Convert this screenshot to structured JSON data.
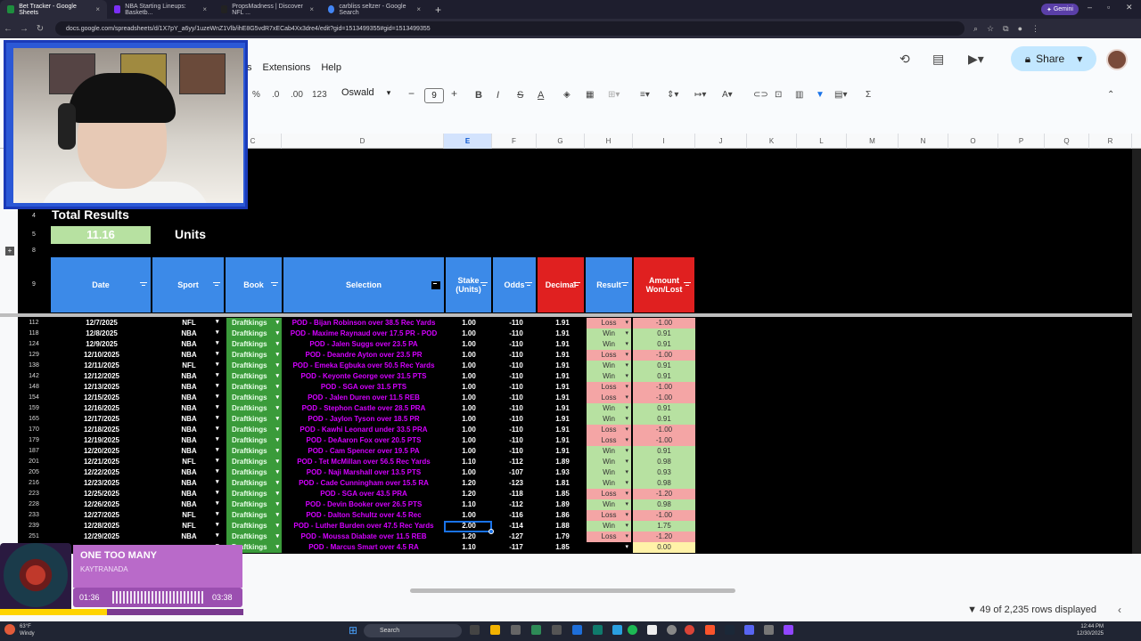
{
  "browser": {
    "tabs": [
      {
        "label": "Bet Tracker - Google Sheets",
        "color": "#1e8e3e",
        "active": true
      },
      {
        "label": "NBA Starting Lineups: Basketb...",
        "color": "#7b2ff7",
        "active": false
      },
      {
        "label": "PropsMadness | Discover NFL ...",
        "color": "#222222",
        "active": false
      },
      {
        "label": "carbliss seltzer - Google Search",
        "color": "#4285f4",
        "active": false
      }
    ],
    "new_tab": "+",
    "gemini_label": "Gemini",
    "url": "docs.google.com/spreadsheets/d/1X7pY_a6yy/1uzeWnZ1Vlb/ihE8G5vdR7xECab4Xx3dre4/edit?gid=1513499355#gid=1513499355"
  },
  "sheets": {
    "menu": [
      "s",
      "Extensions",
      "Help"
    ],
    "share_label": "Share",
    "toolbar": {
      "percent": "%",
      "dec_less": ".0",
      "dec_more": ".00",
      "numformat": "123",
      "font": "Oswald",
      "font_size": "9",
      "minus": "−",
      "plus": "+",
      "bold": "B",
      "italic": "I",
      "strike": "S",
      "text_color": "A",
      "sigma": "Σ"
    },
    "columns": [
      "C",
      "D",
      "E",
      "F",
      "G",
      "H",
      "I",
      "J",
      "K",
      "L",
      "M",
      "N",
      "O",
      "P",
      "Q",
      "R"
    ],
    "selected_column": "E",
    "row_numbers": {
      "r4": "4",
      "r5": "5",
      "r8": "8",
      "r9": "9"
    },
    "totals_label": "Total Results",
    "units_value": "11.16",
    "units_label": "Units",
    "headers": {
      "date": "Date",
      "sport": "Sport",
      "book": "Book",
      "selection": "Selection",
      "stake": "Stake (Units)",
      "odds": "Odds",
      "decimal": "Decimal",
      "result": "Result",
      "amount": "Amount Won/Lost"
    },
    "rows": [
      {
        "row": "112",
        "date": "12/7/2025",
        "sport": "NFL",
        "book": "Draftkings",
        "selection": "POD - Bijan Robinson over 38.5 Rec Yards",
        "stake": "1.00",
        "odds": "-110",
        "decimal": "1.91",
        "result": "Loss",
        "amount": "-1.00"
      },
      {
        "row": "118",
        "date": "12/8/2025",
        "sport": "NBA",
        "book": "Draftkings",
        "selection": "POD - Maxime Raynaud over 17.5 PR - POD",
        "stake": "1.00",
        "odds": "-110",
        "decimal": "1.91",
        "result": "Win",
        "amount": "0.91"
      },
      {
        "row": "124",
        "date": "12/9/2025",
        "sport": "NBA",
        "book": "Draftkings",
        "selection": "POD - Jalen Suggs over 23.5 PA",
        "stake": "1.00",
        "odds": "-110",
        "decimal": "1.91",
        "result": "Win",
        "amount": "0.91"
      },
      {
        "row": "129",
        "date": "12/10/2025",
        "sport": "NBA",
        "book": "Draftkings",
        "selection": "POD - Deandre Ayton over 23.5 PR",
        "stake": "1.00",
        "odds": "-110",
        "decimal": "1.91",
        "result": "Loss",
        "amount": "-1.00"
      },
      {
        "row": "138",
        "date": "12/11/2025",
        "sport": "NFL",
        "book": "Draftkings",
        "selection": "POD - Emeka Egbuka over 50.5 Rec Yards",
        "stake": "1.00",
        "odds": "-110",
        "decimal": "1.91",
        "result": "Win",
        "amount": "0.91"
      },
      {
        "row": "142",
        "date": "12/12/2025",
        "sport": "NBA",
        "book": "Draftkings",
        "selection": "POD - Keyonte George over 31.5 PTS",
        "stake": "1.00",
        "odds": "-110",
        "decimal": "1.91",
        "result": "Win",
        "amount": "0.91"
      },
      {
        "row": "148",
        "date": "12/13/2025",
        "sport": "NBA",
        "book": "Draftkings",
        "selection": "POD - SGA over 31.5 PTS",
        "stake": "1.00",
        "odds": "-110",
        "decimal": "1.91",
        "result": "Loss",
        "amount": "-1.00"
      },
      {
        "row": "154",
        "date": "12/15/2025",
        "sport": "NBA",
        "book": "Draftkings",
        "selection": "POD - Jalen Duren over 11.5 REB",
        "stake": "1.00",
        "odds": "-110",
        "decimal": "1.91",
        "result": "Loss",
        "amount": "-1.00"
      },
      {
        "row": "159",
        "date": "12/16/2025",
        "sport": "NBA",
        "book": "Draftkings",
        "selection": "POD - Stephon Castle over 28.5 PRA",
        "stake": "1.00",
        "odds": "-110",
        "decimal": "1.91",
        "result": "Win",
        "amount": "0.91"
      },
      {
        "row": "165",
        "date": "12/17/2025",
        "sport": "NBA",
        "book": "Draftkings",
        "selection": "POD - Jaylon Tyson over 18.5 PR",
        "stake": "1.00",
        "odds": "-110",
        "decimal": "1.91",
        "result": "Win",
        "amount": "0.91"
      },
      {
        "row": "170",
        "date": "12/18/2025",
        "sport": "NBA",
        "book": "Draftkings",
        "selection": "POD - Kawhi Leonard under 33.5 PRA",
        "stake": "1.00",
        "odds": "-110",
        "decimal": "1.91",
        "result": "Loss",
        "amount": "-1.00"
      },
      {
        "row": "179",
        "date": "12/19/2025",
        "sport": "NBA",
        "book": "Draftkings",
        "selection": "POD - DeAaron Fox over 20.5 PTS",
        "stake": "1.00",
        "odds": "-110",
        "decimal": "1.91",
        "result": "Loss",
        "amount": "-1.00"
      },
      {
        "row": "187",
        "date": "12/20/2025",
        "sport": "NBA",
        "book": "Draftkings",
        "selection": "POD - Cam Spencer over 19.5 PA",
        "stake": "1.00",
        "odds": "-110",
        "decimal": "1.91",
        "result": "Win",
        "amount": "0.91"
      },
      {
        "row": "201",
        "date": "12/21/2025",
        "sport": "NFL",
        "book": "Draftkings",
        "selection": "POD - Tet McMillan over 56.5 Rec Yards",
        "stake": "1.10",
        "odds": "-112",
        "decimal": "1.89",
        "result": "Win",
        "amount": "0.98"
      },
      {
        "row": "205",
        "date": "12/22/2025",
        "sport": "NBA",
        "book": "Draftkings",
        "selection": "POD - Naji Marshall over 13.5 PTS",
        "stake": "1.00",
        "odds": "-107",
        "decimal": "1.93",
        "result": "Win",
        "amount": "0.93"
      },
      {
        "row": "216",
        "date": "12/23/2025",
        "sport": "NBA",
        "book": "Draftkings",
        "selection": "POD - Cade Cunningham over 15.5 RA",
        "stake": "1.20",
        "odds": "-123",
        "decimal": "1.81",
        "result": "Win",
        "amount": "0.98"
      },
      {
        "row": "223",
        "date": "12/25/2025",
        "sport": "NBA",
        "book": "Draftkings",
        "selection": "POD - SGA over 43.5 PRA",
        "stake": "1.20",
        "odds": "-118",
        "decimal": "1.85",
        "result": "Loss",
        "amount": "-1.20"
      },
      {
        "row": "228",
        "date": "12/26/2025",
        "sport": "NBA",
        "book": "Draftkings",
        "selection": "POD - Devin Booker over 26.5 PTS",
        "stake": "1.10",
        "odds": "-112",
        "decimal": "1.89",
        "result": "Win",
        "amount": "0.98"
      },
      {
        "row": "233",
        "date": "12/27/2025",
        "sport": "NFL",
        "book": "Draftkings",
        "selection": "POD - Dalton Schultz over 4.5 Rec",
        "stake": "1.00",
        "odds": "-116",
        "decimal": "1.86",
        "result": "Loss",
        "amount": "-1.00"
      },
      {
        "row": "239",
        "date": "12/28/2025",
        "sport": "NFL",
        "book": "Draftkings",
        "selection": "POD - Luther Burden over 47.5 Rec Yards",
        "stake": "2.00",
        "odds": "-114",
        "decimal": "1.88",
        "result": "Win",
        "amount": "1.75"
      },
      {
        "row": "251",
        "date": "12/29/2025",
        "sport": "NBA",
        "book": "Draftkings",
        "selection": "POD - Moussa Diabate over 11.5 REB",
        "stake": "1.20",
        "odds": "-127",
        "decimal": "1.79",
        "result": "Loss",
        "amount": "-1.20"
      },
      {
        "row": "",
        "date": "",
        "sport": "",
        "book": "Draftkings",
        "selection": "POD - Marcus Smart over 4.5 RA",
        "stake": "1.10",
        "odds": "-117",
        "decimal": "1.85",
        "result": "",
        "amount": "0.00"
      }
    ],
    "rows_displayed": "49 of 2,235 rows displayed"
  },
  "music": {
    "title": "ONE TOO MANY",
    "artist": "KAYTRANADA",
    "time_start": "01:36",
    "time_end": "03:38",
    "progress": 0.44
  },
  "taskbar": {
    "weather_temp": "63°F",
    "weather_desc": "Windy",
    "search": "Search",
    "time": "12:44 PM",
    "date": "12/30/2025"
  },
  "colors": {
    "header_blue": "#3c8ae8",
    "header_red": "#e02020",
    "win_green": "#b7e1a1",
    "loss_red": "#f4a5a5",
    "book_green": "#3a9b3a",
    "selection_magenta": "#d400ff"
  }
}
